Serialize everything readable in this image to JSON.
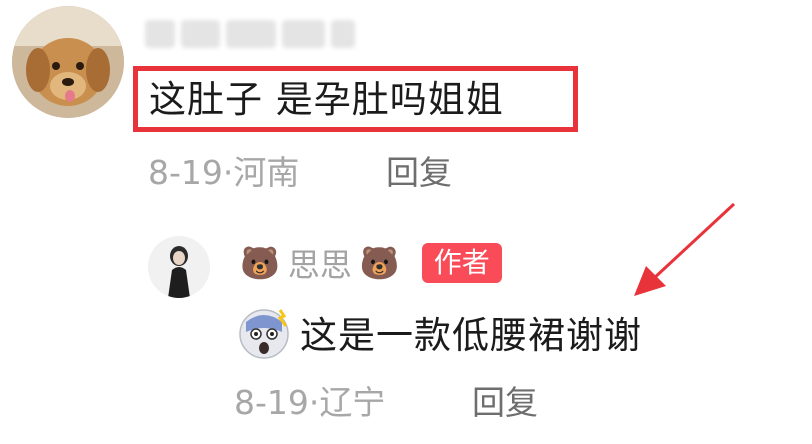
{
  "comment": {
    "text": "这肚子 是孕肚吗姐姐",
    "meta": "8-19·河南",
    "reply_label": "回复",
    "highlight_color": "#e8333a"
  },
  "reply": {
    "prefix_emoji": "🐻",
    "author_name": "思思",
    "suffix_emoji": "🐻",
    "author_badge": "作者",
    "text_emoji": "😨",
    "text": "这是一款低腰裙谢谢",
    "meta": "8-19·辽宁",
    "reply_label": "回复",
    "badge_color": "#f94b58"
  },
  "annotation": {
    "arrow_color": "#e8333a"
  }
}
